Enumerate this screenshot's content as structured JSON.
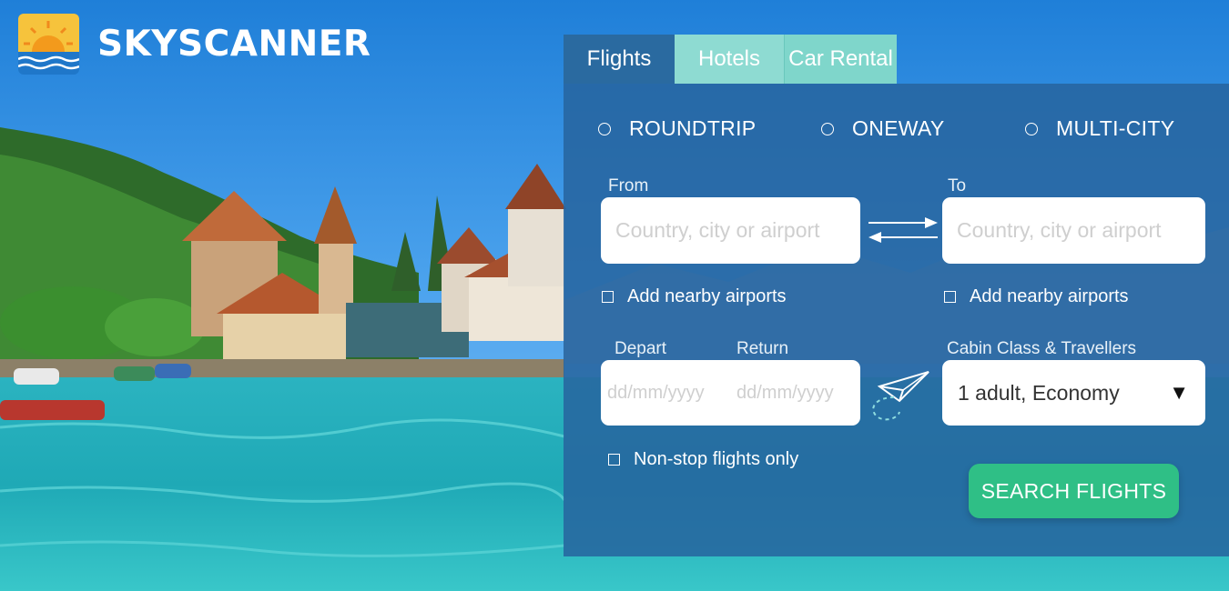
{
  "brand": {
    "name": "SKYSCANNER"
  },
  "tabs": [
    {
      "label": "Flights",
      "active": true
    },
    {
      "label": "Hotels",
      "active": false
    },
    {
      "label": "Car Rental",
      "active": false
    }
  ],
  "trip_types": [
    {
      "label": "ROUNDTRIP"
    },
    {
      "label": "ONEWAY"
    },
    {
      "label": "MULTI-CITY"
    }
  ],
  "from": {
    "label": "From",
    "placeholder": "Country, city or airport",
    "nearby_label": "Add nearby airports"
  },
  "to": {
    "label": "To",
    "placeholder": "Country, city or airport",
    "nearby_label": "Add nearby airports"
  },
  "depart": {
    "label": "Depart",
    "placeholder": "dd/mm/yyyy"
  },
  "return": {
    "label": "Return",
    "placeholder": "dd/mm/yyyy"
  },
  "cabin": {
    "label": "Cabin Class & Travellers",
    "value": "1 adult, Economy"
  },
  "nonstop": {
    "label": "Non-stop flights only"
  },
  "search_button": {
    "label": "SEARCH FLIGHTS"
  },
  "colors": {
    "panel": "#26649e",
    "tab_active": "#2a6aa0",
    "tab_inactive": "#8edbd2",
    "search_button": "#2fbf86"
  },
  "icons": [
    "sun-logo-icon",
    "swap-arrows-icon",
    "paper-plane-icon",
    "caret-down-icon"
  ]
}
